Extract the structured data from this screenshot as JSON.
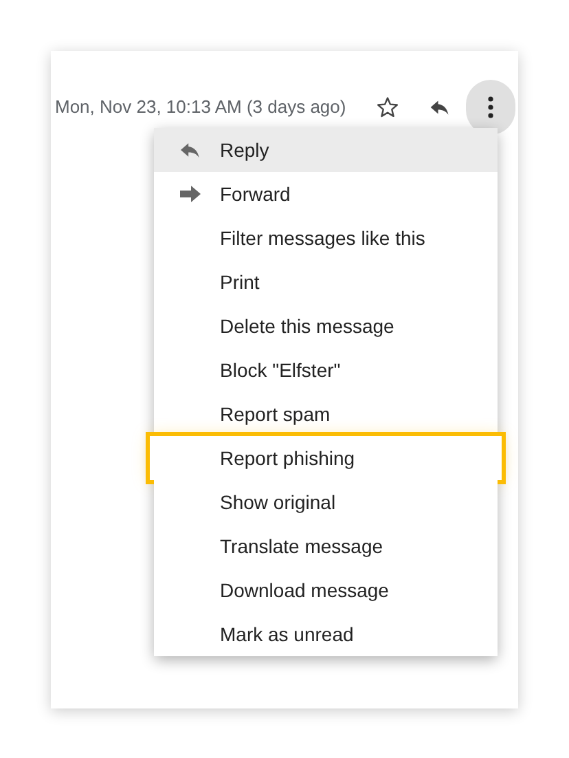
{
  "header": {
    "date": "Mon, Nov 23, 10:13 AM (3 days ago)"
  },
  "menu": {
    "items": [
      {
        "label": "Reply",
        "kind": "reply",
        "selected": true,
        "highlighted": false
      },
      {
        "label": "Forward",
        "kind": "forward",
        "selected": false,
        "highlighted": false
      },
      {
        "label": "Filter messages like this",
        "kind": "plain",
        "selected": false,
        "highlighted": false
      },
      {
        "label": "Print",
        "kind": "plain",
        "selected": false,
        "highlighted": false
      },
      {
        "label": "Delete this message",
        "kind": "plain",
        "selected": false,
        "highlighted": false
      },
      {
        "label": "Block \"Elfster\"",
        "kind": "plain",
        "selected": false,
        "highlighted": false
      },
      {
        "label": "Report spam",
        "kind": "plain",
        "selected": false,
        "highlighted": false
      },
      {
        "label": "Report phishing",
        "kind": "plain",
        "selected": false,
        "highlighted": true
      },
      {
        "label": "Show original",
        "kind": "plain",
        "selected": false,
        "highlighted": false
      },
      {
        "label": "Translate message",
        "kind": "plain",
        "selected": false,
        "highlighted": false
      },
      {
        "label": "Download message",
        "kind": "plain",
        "selected": false,
        "highlighted": false
      },
      {
        "label": "Mark as unread",
        "kind": "plain",
        "selected": false,
        "highlighted": false
      }
    ]
  }
}
